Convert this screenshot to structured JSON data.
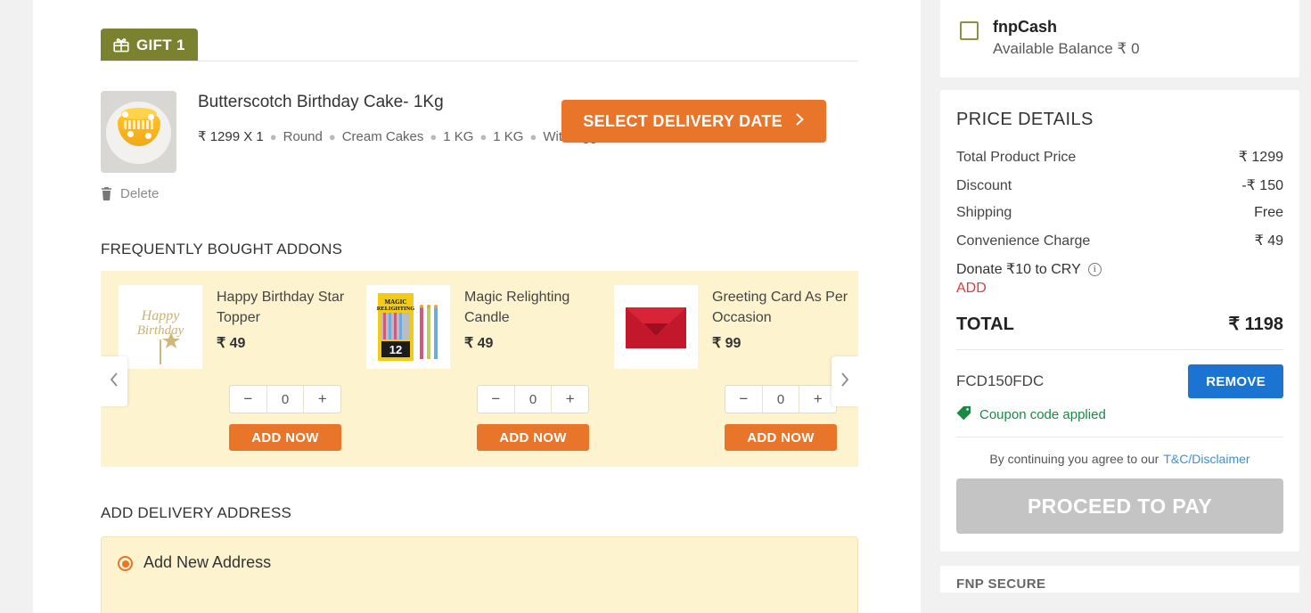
{
  "gift": {
    "badge_label": "GIFT 1",
    "badge_color": "#7b822f",
    "icon": "gift-box-icon"
  },
  "product": {
    "title": "Butterscotch Birthday Cake- 1Kg",
    "meta": [
      "₹ 1299 X 1",
      "Round",
      "Cream Cakes",
      "1 KG",
      "1 KG",
      "With Egg"
    ],
    "delete_label": "Delete",
    "delete_icon": "trash-icon",
    "select_delivery_label": "SELECT DELIVERY DATE",
    "select_delivery_chevron": "›",
    "accent_color": "#e8752a"
  },
  "addons": {
    "heading": "FREQUENTLY BOUGHT ADDONS",
    "panel_color": "#fdf3cf",
    "prev_icon": "chevron-left-icon",
    "next_icon": "chevron-right-icon",
    "items": [
      {
        "name": "Happy Birthday Star Topper",
        "price": "₹ 49",
        "qty": "0",
        "add_label": "ADD NOW",
        "image": "gold-birthday-topper-image"
      },
      {
        "name": "Magic Relighting Candle",
        "price": "₹ 49",
        "qty": "0",
        "add_label": "ADD NOW",
        "image": "magic-relighting-candle-pack-image"
      },
      {
        "name": "Greeting Card As Per Occasion",
        "price": "₹ 99",
        "qty": "0",
        "add_label": "ADD NOW",
        "image": "red-envelope-image"
      }
    ],
    "minus": "−",
    "plus": "+"
  },
  "address": {
    "heading": "ADD DELIVERY ADDRESS",
    "option_label": "Add New Address",
    "selected": true
  },
  "fnpcash": {
    "title": "fnpCash",
    "balance_label": "Available Balance ₹ 0",
    "checked": false,
    "checkbox_color": "#8a9244"
  },
  "price_details": {
    "heading": "PRICE DETAILS",
    "rows": [
      {
        "label": "Total Product Price",
        "value": "₹ 1299",
        "color": "#333333"
      },
      {
        "label": "Discount",
        "value": "-₹ 150",
        "color": "#1a8a44"
      },
      {
        "label": "Shipping",
        "value": "Free",
        "color": "#1a8a44"
      },
      {
        "label": "Convenience Charge",
        "value": "₹ 49",
        "color": "#333333"
      }
    ],
    "donate_label": "Donate ₹10 to CRY",
    "donate_info_icon": "info-icon",
    "donate_add_label": "ADD",
    "donate_add_color": "#e03b3b",
    "total_label": "TOTAL",
    "total_value": "₹ 1198"
  },
  "coupon": {
    "code": "FCD150FDC",
    "remove_label": "REMOVE",
    "remove_color": "#1b74d1",
    "applied_text": "Coupon code applied",
    "applied_color": "#1a8a44",
    "tag_icon": "tag-icon"
  },
  "footer": {
    "tnc_prefix": "By continuing you agree to our",
    "tnc_link": "T&C/Disclaimer",
    "pay_label": "PROCEED TO PAY",
    "pay_enabled": false,
    "secure_label": "FNP SECURE"
  }
}
